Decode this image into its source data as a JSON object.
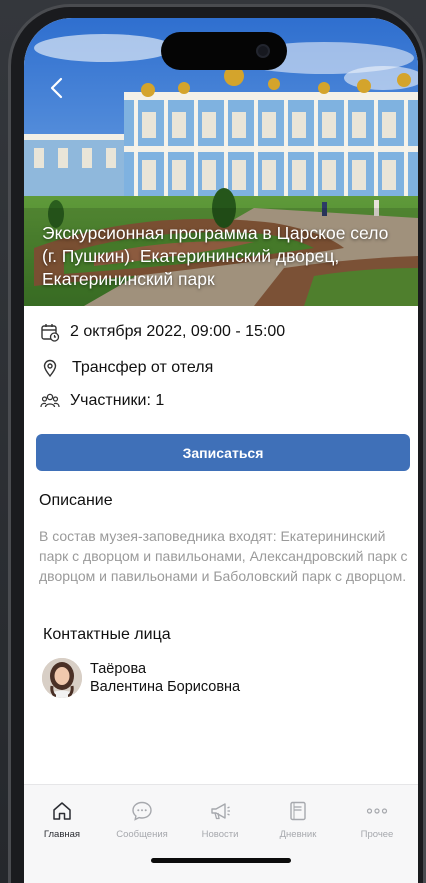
{
  "event": {
    "title": "Экскурсионная программа в Царское село (г. Пушкин). Екатерининский дворец, Екатерининский парк",
    "date": "2 октября 2022, 09:00 - 15:00",
    "location": "Трансфер от отеля",
    "participants": "Участники: 1"
  },
  "signup_button": "Записаться",
  "description": {
    "heading": "Описание",
    "text": "В состав музея-заповедника входят: Екатерининский парк с дворцом и павильонами, Александровский парк с дворцом и павильонами и Баболовский парк с дворцом."
  },
  "contacts": {
    "heading": "Контактные лица",
    "person": {
      "surname": "Таёрова",
      "given": "Валентина Борисовна"
    }
  },
  "tabbar": {
    "items": [
      {
        "label": "Главная",
        "icon": "home-icon",
        "active": true
      },
      {
        "label": "Сообщения",
        "icon": "chat-icon",
        "active": false
      },
      {
        "label": "Новости",
        "icon": "megaphone-icon",
        "active": false
      },
      {
        "label": "Дневник",
        "icon": "diary-icon",
        "active": false
      },
      {
        "label": "Прочее",
        "icon": "more-icon",
        "active": false
      }
    ]
  },
  "colors": {
    "accent": "#3f70b8",
    "muted_text": "#9a9a9a",
    "tab_active": "#2b2d33",
    "tab_inactive": "#a6a8ad"
  }
}
